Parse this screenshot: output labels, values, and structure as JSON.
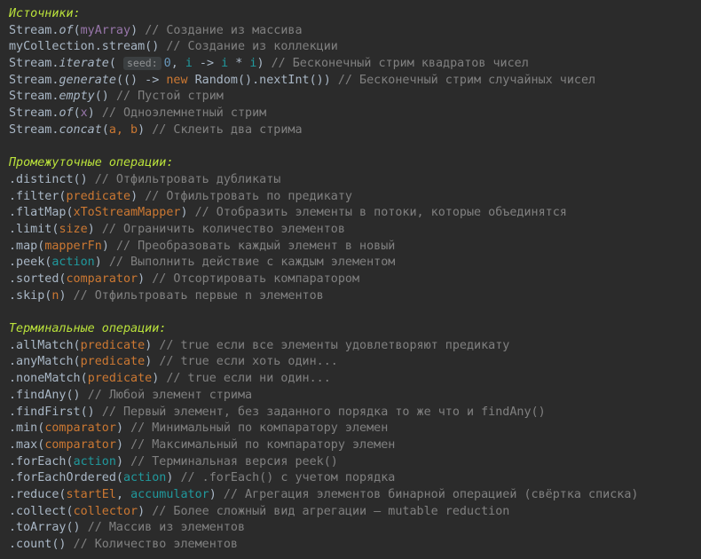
{
  "sections": {
    "sources": {
      "title": "Источники:",
      "lines": {
        "0": {
          "a": "Stream.",
          "m": "of",
          "b": "(",
          "arg": "myArray",
          "c": ") ",
          "cm": "// Создание из массива"
        },
        "1": {
          "a": "myCollection.stream() ",
          "cm": "// Создание из коллекции"
        },
        "2": {
          "a": "Stream.",
          "m": "iterate",
          "b": "( ",
          "hint": "seed:",
          "n": "0",
          ",": ", ",
          "v1": "i",
          " ->": " -> ",
          "v2": "i",
          "op": " * ",
          "v3": "i",
          "c": ") ",
          "cm": "// Бесконечный стрим квадратов чисел"
        },
        "3": {
          "a": "Stream.",
          "m": "generate",
          "b": "(() -> ",
          "kw": "new",
          "c": " Random().nextInt()) ",
          "cm": "// Бесконечный стрим случайных чисел"
        },
        "4": {
          "a": "Stream.",
          "m": "empty",
          "c": "() ",
          "cm": "// Пустой стрим"
        },
        "5": {
          "a": "Stream.",
          "m": "of",
          "b": "(",
          "arg": "x",
          "c": ") ",
          "cm": "// Одноэлемнетный стрим"
        },
        "6": {
          "a": "Stream.",
          "m": "concat",
          "b": "(",
          "arg": "a, b",
          "c": ") ",
          "cm": "// Склеить два стрима"
        }
      }
    },
    "intermediate": {
      "title": "Промежуточные операции:",
      "lines": {
        "0": {
          "a": ".distinct() ",
          "cm": "// Отфильтровать дубликаты"
        },
        "1": {
          "a": ".filter(",
          "arg": "predicate",
          "c": ") ",
          "cm": "// Отфильтровать по предикату"
        },
        "2": {
          "a": ".flatMap(",
          "arg": "xToStreamMapper",
          "c": ") ",
          "cm": "// Отобразить элементы в потоки, которые объединятся"
        },
        "3": {
          "a": ".limit(",
          "arg": "size",
          "c": ") ",
          "cm": "// Ограничить количество элементов"
        },
        "4": {
          "a": ".map(",
          "arg": "mapperFn",
          "c": ") ",
          "cm": "// Преобразовать каждый элемент в новый"
        },
        "5": {
          "a": ".peek(",
          "arg": "action",
          "c": ") ",
          "cm": "// Выполнить действие с каждым элементом"
        },
        "6": {
          "a": ".sorted(",
          "arg": "comparator",
          "c": ") ",
          "cm": "// Отсортировать компаратором"
        },
        "7": {
          "a": ".skip(",
          "arg": "n",
          "c": ") ",
          "cm": "// Отфильтровать первые n элементов"
        }
      }
    },
    "terminal": {
      "title": "Терминальные операции:",
      "lines": {
        "0": {
          "a": ".allMatch(",
          "arg": "predicate",
          "c": ") ",
          "cm": "// true если все элементы удовлетворяют предикату"
        },
        "1": {
          "a": ".anyMatch(",
          "arg": "predicate",
          "c": ") ",
          "cm": "// true если хоть один..."
        },
        "2": {
          "a": ".noneMatch(",
          "arg": "predicate",
          "c": ") ",
          "cm": "// true если ни один..."
        },
        "3": {
          "a": ".findAny() ",
          "cm": "// Любой элемент стрима"
        },
        "4": {
          "a": ".findFirst() ",
          "cm": "// Первый элемент, без заданного порядка то же что и findAny()"
        },
        "5": {
          "a": ".min(",
          "arg": "comparator",
          "c": ") ",
          "cm": "// Минимальный по компаратору элемен"
        },
        "6": {
          "a": ".max(",
          "arg": "comparator",
          "c": ") ",
          "cm": "// Максимальный по компаратору элемен"
        },
        "7": {
          "a": ".forEach(",
          "arg": "action",
          "c": ") ",
          "cm": "// Терминальная версия peek()"
        },
        "8": {
          "a": ".forEachOrdered(",
          "arg": "action",
          "c": ") ",
          "cm": "// .forEach() с учетом порядка"
        },
        "9": {
          "a": ".reduce(",
          "arg": "startEl",
          "sep": ", ",
          "arg2": "accumulator",
          "c": ") ",
          "cm": "// Агрегация элементов бинарной операцией (свёртка списка)"
        },
        "10": {
          "a": ".collect(",
          "arg": "collector",
          "c": ") ",
          "cm": "// Более сложный вид агрегации — mutable reduction"
        },
        "11": {
          "a": ".toArray() ",
          "cm": "// Массив из элементов"
        },
        "12": {
          "a": ".count() ",
          "cm": "// Количество элементов"
        }
      }
    }
  },
  "colors": {
    "background": "#2b2b2b",
    "text": "#a9b7c6",
    "heading": "#bbe33b",
    "comment": "#808080",
    "variable": "#9876aa",
    "parameter": "#cc7832",
    "lambda_param": "#20999d",
    "number": "#6897bb"
  }
}
